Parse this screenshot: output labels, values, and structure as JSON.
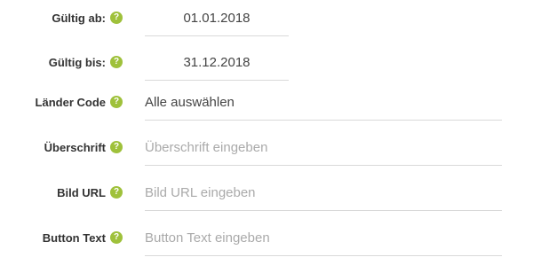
{
  "form": {
    "valid_from": {
      "label": "Gültig ab:",
      "value": "01.01.2018"
    },
    "valid_to": {
      "label": "Gültig bis:",
      "value": "31.12.2018"
    },
    "country_code": {
      "label": "Länder Code",
      "value": "Alle auswählen"
    },
    "heading": {
      "label": "Überschrift",
      "placeholder": "Überschrift eingeben"
    },
    "image_url": {
      "label": "Bild URL",
      "placeholder": "Bild URL eingeben"
    },
    "button_text": {
      "label": "Button Text",
      "placeholder": "Button Text eingeben"
    },
    "help_glyph": "?",
    "help_icon": "question-circle-icon",
    "accent_color": "#9fc13b"
  }
}
